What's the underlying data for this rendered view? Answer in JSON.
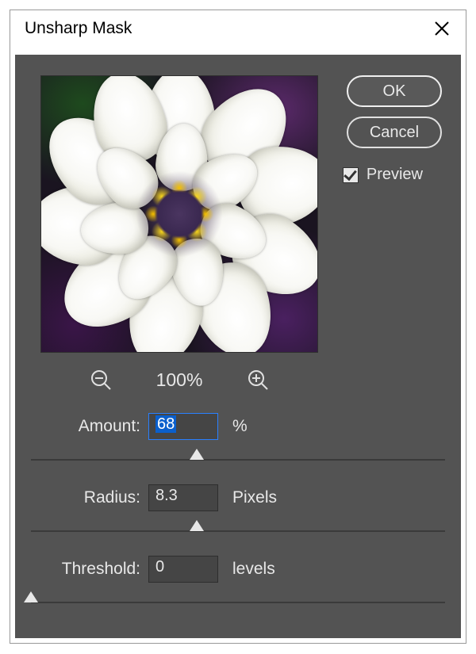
{
  "dialog": {
    "title": "Unsharp Mask"
  },
  "buttons": {
    "ok": "OK",
    "cancel": "Cancel"
  },
  "preview_checkbox": {
    "label": "Preview",
    "checked": true
  },
  "zoom": {
    "level": "100%"
  },
  "params": {
    "amount": {
      "label": "Amount:",
      "value": "68",
      "unit": "%",
      "slider_pct": 40
    },
    "radius": {
      "label": "Radius:",
      "value": "8.3",
      "unit": "Pixels",
      "slider_pct": 40
    },
    "threshold": {
      "label": "Threshold:",
      "value": "0",
      "unit": "levels",
      "slider_pct": 0
    }
  }
}
